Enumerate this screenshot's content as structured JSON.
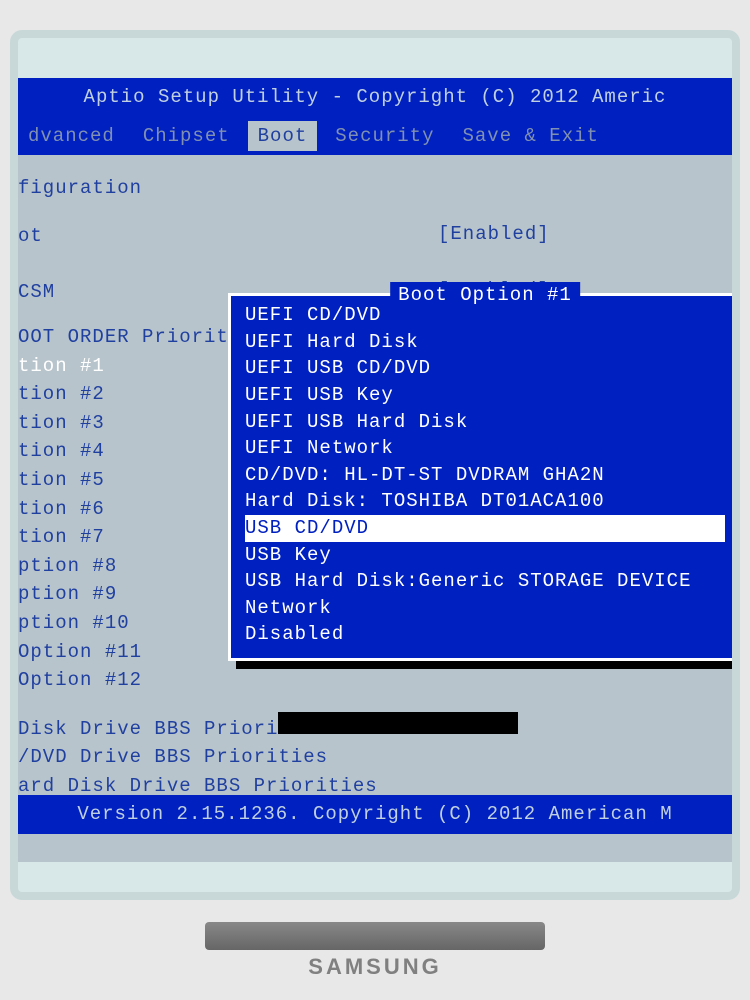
{
  "header": {
    "title": "Aptio Setup Utility - Copyright (C) 2012 Americ"
  },
  "tabs": [
    {
      "label": "dvanced"
    },
    {
      "label": "Chipset"
    },
    {
      "label": "Boot"
    },
    {
      "label": "Security"
    },
    {
      "label": "Save & Exit"
    }
  ],
  "active_tab": "Boot",
  "section": {
    "title": "figuration",
    "items_top": [
      {
        "label": "ot",
        "value": "[Enabled]"
      },
      {
        "label": "CSM",
        "value": "[Enabled]"
      }
    ],
    "order_header": "OOT ORDER Priorit",
    "boot_options": [
      "tion #1",
      "tion #2",
      "tion #3",
      "tion #4",
      "tion #5",
      "tion #6",
      "tion #7",
      "ption #8",
      "ption #9",
      "ption #10",
      "Option #11",
      "Option #12"
    ],
    "sub_items": [
      "Disk Drive BBS Priori",
      "/DVD Drive BBS Priorities",
      "ard Disk Drive BBS Priorities"
    ]
  },
  "popup": {
    "title": "Boot Option #1",
    "items": [
      "UEFI CD/DVD",
      "UEFI Hard Disk",
      "UEFI USB CD/DVD",
      "UEFI USB Key",
      "UEFI USB Hard Disk",
      "UEFI Network",
      "CD/DVD: HL-DT-ST DVDRAM GHA2N",
      "Hard Disk: TOSHIBA DT01ACA100",
      "USB CD/DVD",
      "USB Key",
      "USB Hard Disk:Generic STORAGE DEVICE",
      "Network",
      "Disabled"
    ],
    "highlighted_index": 8
  },
  "footer": {
    "text": "Version 2.15.1236. Copyright (C) 2012 American M"
  },
  "monitor_brand": "SAMSUNG"
}
